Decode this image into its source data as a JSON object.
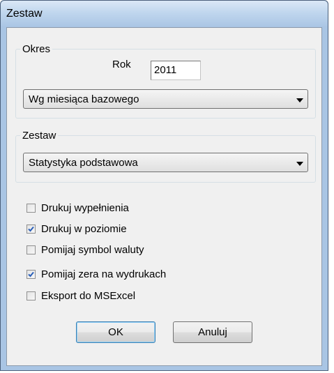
{
  "window": {
    "title": "Zestaw"
  },
  "okres": {
    "legend": "Okres",
    "rok_label": "Rok",
    "rok_value": "2011",
    "mode_value": "Wg miesiąca bazowego"
  },
  "zestaw": {
    "legend": "Zestaw",
    "value": "Statystyka podstawowa"
  },
  "options": [
    {
      "label": "Drukuj wypełnienia",
      "checked": false
    },
    {
      "label": "Drukuj w poziomie",
      "checked": true
    },
    {
      "label": "Pomijaj symbol waluty",
      "checked": false
    },
    {
      "label": "Pomijaj zera na wydrukach",
      "checked": true
    },
    {
      "label": "Eksport do MSExcel",
      "checked": false
    }
  ],
  "buttons": {
    "ok": "OK",
    "cancel": "Anuluj"
  },
  "icons": {
    "combo_arrow": "dropdown-arrow-icon",
    "check": "checkmark-icon"
  },
  "colors": {
    "titlebar": "#a9c5e4",
    "client": "#f0f0f0",
    "check": "#2a5fb8"
  }
}
